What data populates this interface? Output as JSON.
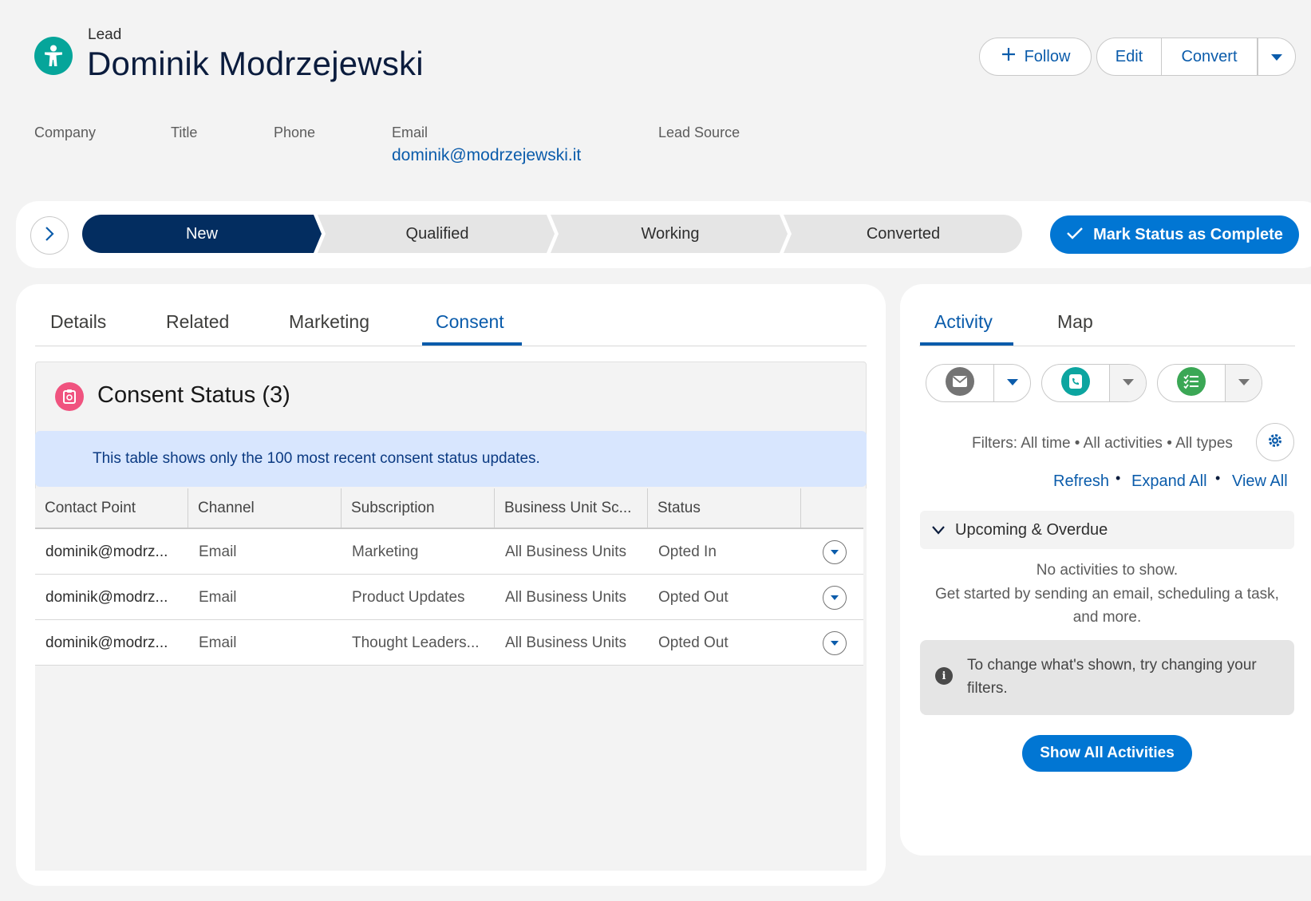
{
  "record": {
    "object_type": "Lead",
    "name": "Dominik Modrzejewski",
    "follow_label": "Follow",
    "edit_label": "Edit",
    "convert_label": "Convert"
  },
  "highlights": [
    {
      "label": "Company",
      "value": ""
    },
    {
      "label": "Title",
      "value": ""
    },
    {
      "label": "Phone",
      "value": ""
    },
    {
      "label": "Email",
      "value": "dominik@modrzejewski.it"
    },
    {
      "label": "Lead Source",
      "value": ""
    }
  ],
  "path": {
    "stages": [
      "New",
      "Qualified",
      "Working",
      "Converted"
    ],
    "current_stage": "New",
    "mark_complete_label": "Mark Status as Complete"
  },
  "tabs": [
    {
      "label": "Details",
      "active": false
    },
    {
      "label": "Related",
      "active": false
    },
    {
      "label": "Marketing",
      "active": false
    },
    {
      "label": "Consent",
      "active": true
    }
  ],
  "consent": {
    "title": "Consent Status (3)",
    "info": "This table shows only the 100 most recent consent status updates.",
    "columns": [
      "Contact Point",
      "Channel",
      "Subscription",
      "Business Unit Sc...",
      "Status"
    ],
    "rows": [
      {
        "contact_point": "dominik@modrz...",
        "channel": "Email",
        "subscription": "Marketing",
        "business_unit": "All Business Units",
        "status": "Opted In"
      },
      {
        "contact_point": "dominik@modrz...",
        "channel": "Email",
        "subscription": "Product Updates",
        "business_unit": "All Business Units",
        "status": "Opted Out"
      },
      {
        "contact_point": "dominik@modrz...",
        "channel": "Email",
        "subscription": "Thought Leaders...",
        "business_unit": "All Business Units",
        "status": "Opted Out"
      }
    ]
  },
  "activity": {
    "tabs": [
      {
        "label": "Activity",
        "active": true
      },
      {
        "label": "Map",
        "active": false
      }
    ],
    "quick_actions": [
      {
        "icon": "email-icon",
        "color": "#747474"
      },
      {
        "icon": "log-call-icon",
        "color": "#0ca5a0"
      },
      {
        "icon": "new-task-icon",
        "color": "#3ba755"
      }
    ],
    "filters": "Filters: All time • All activities • All types",
    "links": [
      "Refresh",
      "Expand All",
      "View All"
    ],
    "section": "Upcoming & Overdue",
    "empty_line1": "No activities to show.",
    "empty_line2": "Get started by sending an email, scheduling a task,",
    "empty_line3": "and more.",
    "tip": "To change what's shown, try changing your filters.",
    "show_all_label": "Show All Activities"
  },
  "colors": {
    "brand": "#0176d3",
    "link": "#0b5cab",
    "path_active": "#032d60",
    "lead_icon": "#06a59a",
    "consent_icon": "#f0537f"
  }
}
